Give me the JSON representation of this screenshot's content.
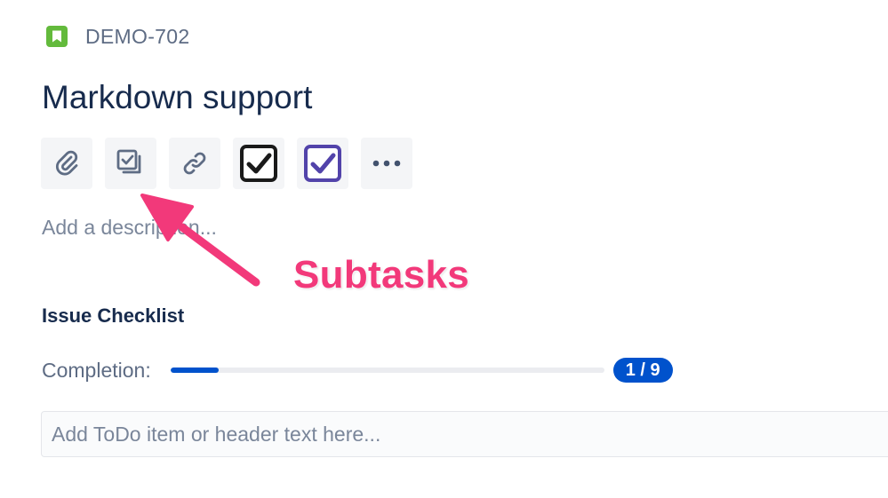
{
  "issue": {
    "key": "DEMO-702",
    "type_icon": "story-bookmark-icon",
    "title": "Markdown support"
  },
  "toolbar": {
    "buttons": [
      {
        "name": "attach",
        "icon": "paperclip-icon"
      },
      {
        "name": "subtasks",
        "icon": "subtask-icon"
      },
      {
        "name": "link-issue",
        "icon": "link-icon"
      },
      {
        "name": "checklist-black",
        "icon": "checkbox-checked-black-icon"
      },
      {
        "name": "checklist-purple",
        "icon": "checkbox-checked-purple-icon"
      },
      {
        "name": "more",
        "icon": "more-horizontal-icon"
      }
    ]
  },
  "description": {
    "placeholder": "Add a description..."
  },
  "annotation": {
    "label": "Subtasks",
    "color": "#f2397a"
  },
  "checklist": {
    "title": "Issue Checklist",
    "completion_label": "Completion:",
    "completed": 1,
    "total": 9,
    "progress_fraction": 0.1111,
    "badge": "1 / 9",
    "input_placeholder": "Add ToDo item or header text here..."
  },
  "colors": {
    "accent": "#0052cc",
    "story_green": "#63ba3c",
    "purple": "#5243aa",
    "text_primary": "#172b4d",
    "text_subtle": "#5e6c84"
  }
}
